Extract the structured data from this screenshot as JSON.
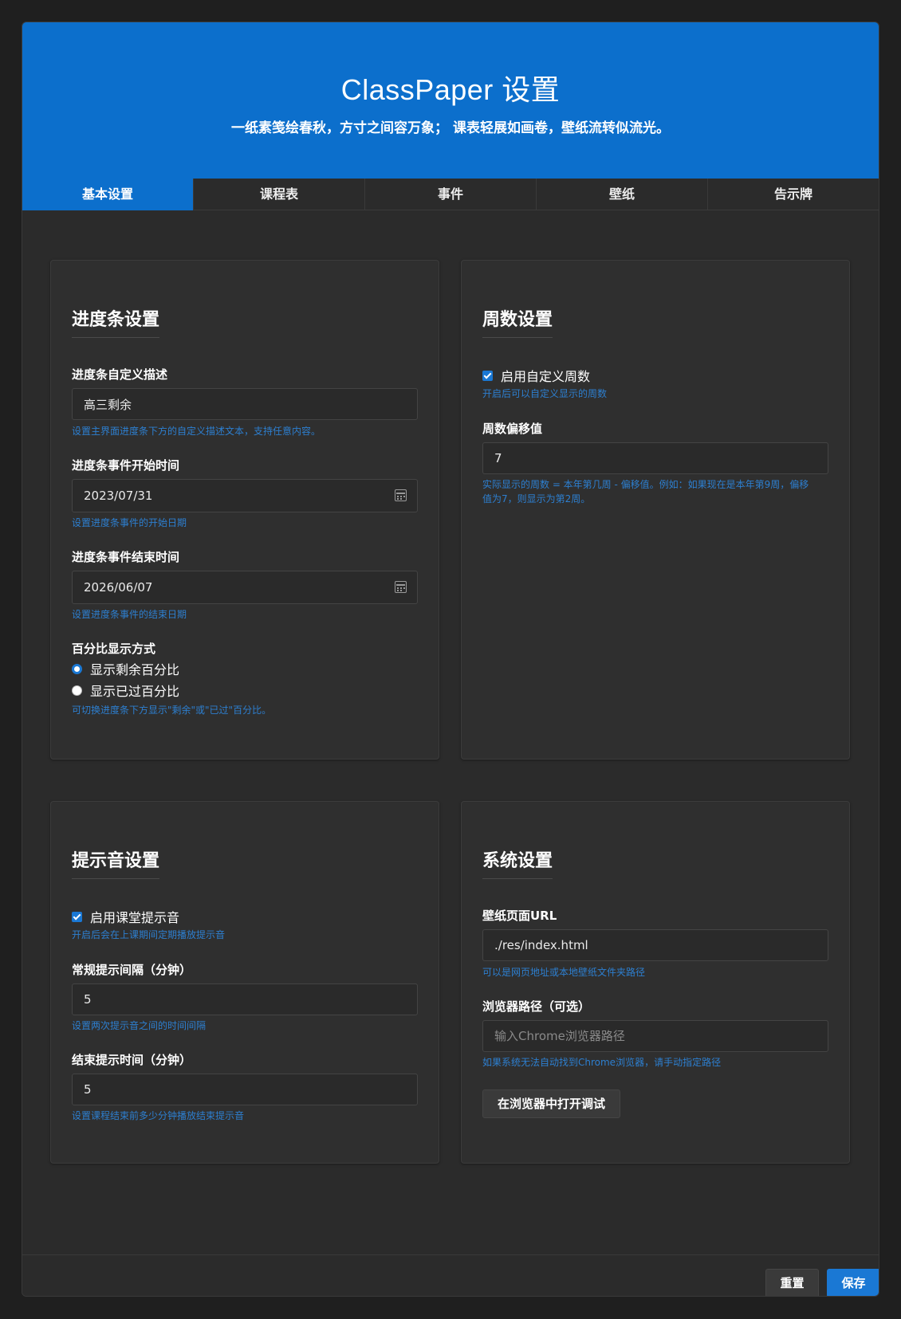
{
  "header": {
    "title": "ClassPaper 设置",
    "subtitle": "一纸素笺绘春秋，方寸之间容万象； 课表轻展如画卷，壁纸流转似流光。"
  },
  "tabs": [
    {
      "label": "基本设置",
      "active": true
    },
    {
      "label": "课程表",
      "active": false
    },
    {
      "label": "事件",
      "active": false
    },
    {
      "label": "壁纸",
      "active": false
    },
    {
      "label": "告示牌",
      "active": false
    }
  ],
  "progress": {
    "title": "进度条设置",
    "desc_label": "进度条自定义描述",
    "desc_value": "高三剩余",
    "desc_hint": "设置主界面进度条下方的自定义描述文本，支持任意内容。",
    "start_label": "进度条事件开始时间",
    "start_value": "2023/07/31",
    "start_hint": "设置进度条事件的开始日期",
    "end_label": "进度条事件结束时间",
    "end_value": "2026/06/07",
    "end_hint": "设置进度条事件的结束日期",
    "mode_label": "百分比显示方式",
    "mode_remaining": "显示剩余百分比",
    "mode_elapsed": "显示已过百分比",
    "mode_selected": "remaining",
    "mode_hint": "可切换进度条下方显示\"剩余\"或\"已过\"百分比。"
  },
  "week": {
    "title": "周数设置",
    "enable_label": "启用自定义周数",
    "enable_checked": true,
    "enable_hint": "开启后可以自定义显示的周数",
    "offset_label": "周数偏移值",
    "offset_value": "7",
    "offset_hint": "实际显示的周数 = 本年第几周 - 偏移值。例如：如果现在是本年第9周，偏移值为7，则显示为第2周。"
  },
  "sound": {
    "title": "提示音设置",
    "enable_label": "启用课堂提示音",
    "enable_checked": true,
    "enable_hint": "开启后会在上课期间定期播放提示音",
    "interval_label": "常规提示间隔（分钟）",
    "interval_value": "5",
    "interval_hint": "设置两次提示音之间的时间间隔",
    "end_label": "结束提示时间（分钟）",
    "end_value": "5",
    "end_hint": "设置课程结束前多少分钟播放结束提示音"
  },
  "system": {
    "title": "系统设置",
    "url_label": "壁纸页面URL",
    "url_value": "./res/index.html",
    "url_hint": "可以是网页地址或本地壁纸文件夹路径",
    "browser_label": "浏览器路径（可选）",
    "browser_placeholder": "输入Chrome浏览器路径",
    "browser_hint": "如果系统无法自动找到Chrome浏览器，请手动指定路径",
    "debug_button": "在浏览器中打开调试"
  },
  "footer": {
    "reset_label": "重置",
    "save_label": "保存"
  },
  "colors": {
    "accent": "#0c6fcc",
    "hint": "#2d7fd0",
    "background": "#2b2b2b"
  }
}
